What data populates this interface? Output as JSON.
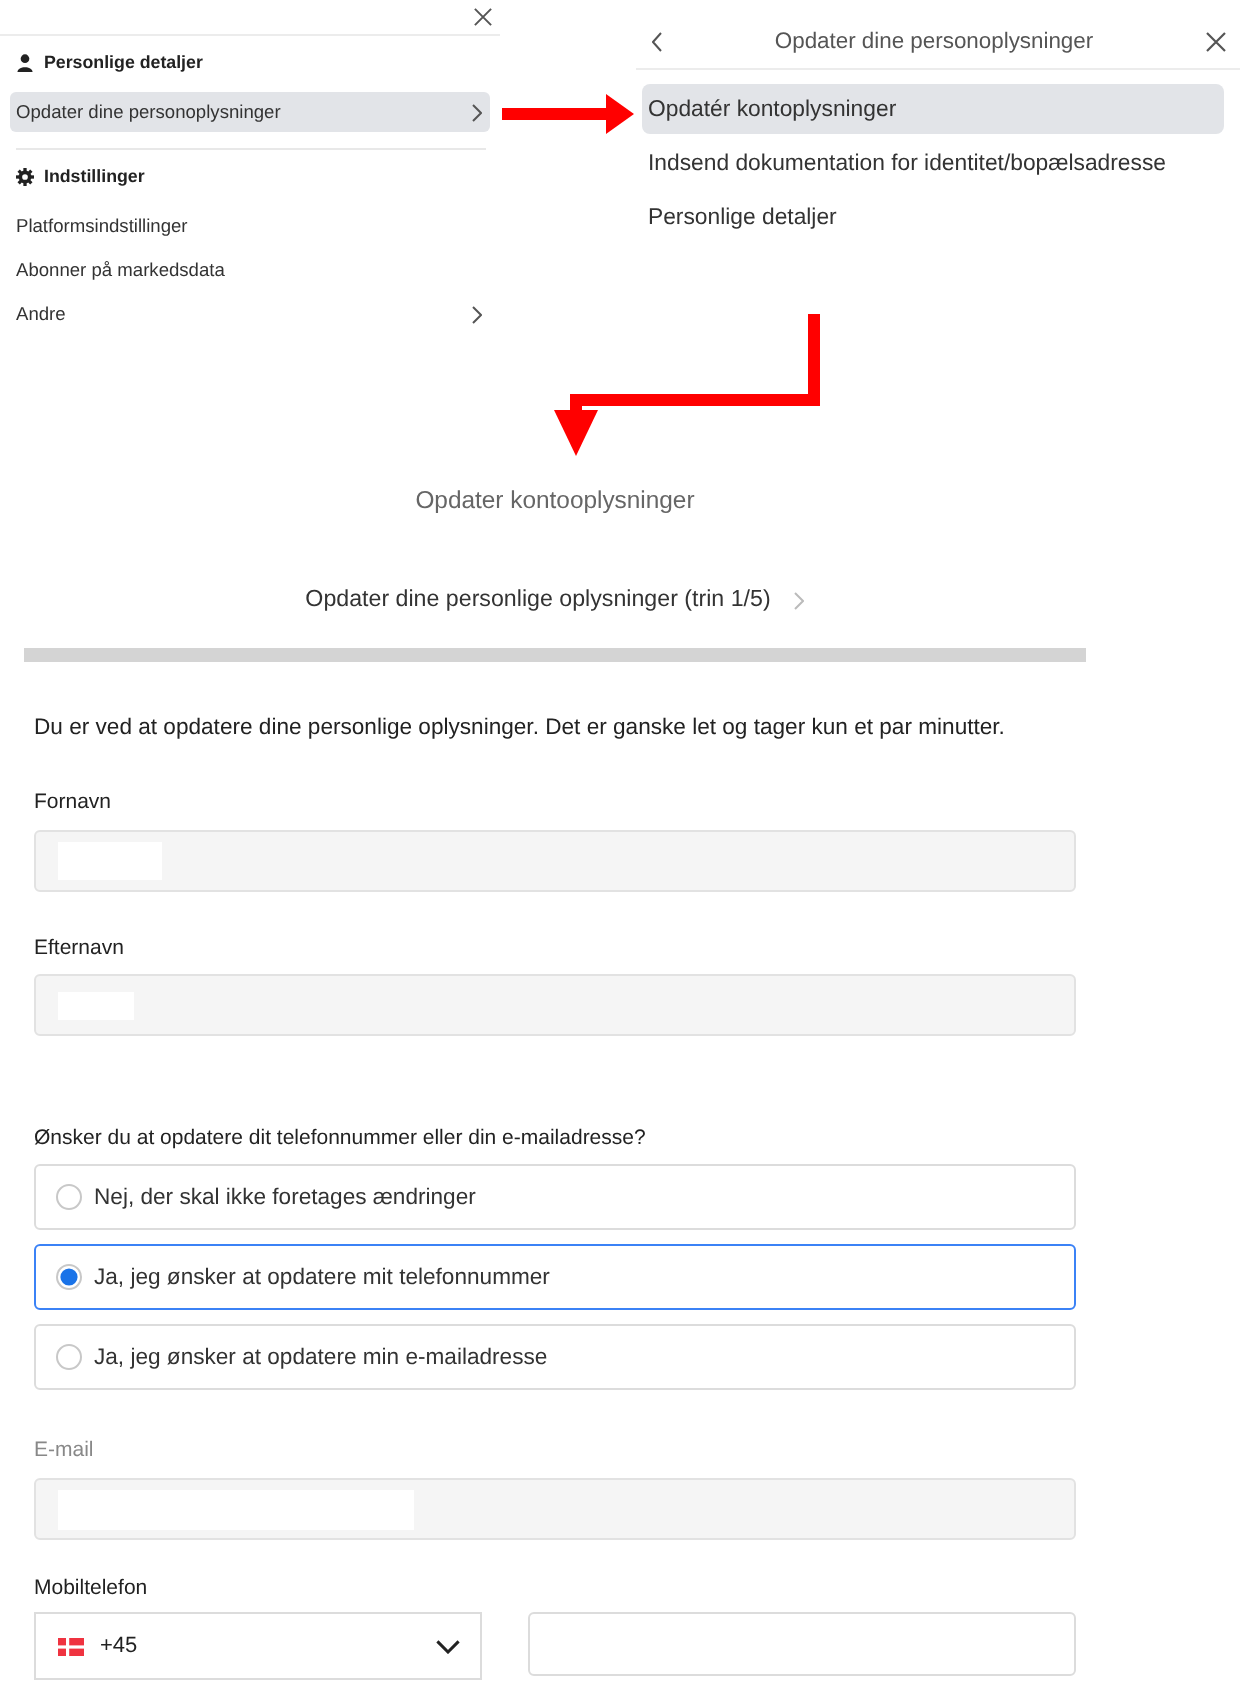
{
  "settings_menu": {
    "sections": [
      {
        "kind": "profile",
        "title": "Personlige detaljer",
        "items": [
          {
            "label": "Opdater dine personoplysninger",
            "selected": true,
            "submenu": true
          }
        ]
      },
      {
        "kind": "settings",
        "title": "Indstillinger",
        "items": [
          {
            "label": "Platformsindstillinger",
            "selected": false,
            "submenu": false
          },
          {
            "label": "Abonner på markedsdata",
            "selected": false,
            "submenu": false
          },
          {
            "label": "Andre",
            "selected": false,
            "submenu": true
          }
        ]
      }
    ]
  },
  "submenu": {
    "title": "Opdater dine personoplysninger",
    "items": [
      {
        "label": "Opdatér kontoplysninger",
        "selected": true
      },
      {
        "label": "Indsend dokumentation for identitet/bopælsadresse",
        "selected": false
      },
      {
        "label": "Personlige detaljer",
        "selected": false
      }
    ]
  },
  "form": {
    "title": "Opdater kontooplysninger",
    "step": "Opdater dine personlige oplysninger (trin 1/5)",
    "intro": "Du er ved at opdatere dine personlige oplysninger. Det er ganske let og tager kun et par minutter.",
    "name_fields": [
      {
        "label": "Fornavn",
        "disabled": false
      },
      {
        "label": "Efternavn",
        "disabled": false
      }
    ],
    "contact_question": "Ønsker du at opdatere dit telefonnummer eller din e-mailadresse?",
    "options": [
      {
        "label": "Nej, der skal ikke foretages ændringer",
        "selected": false
      },
      {
        "label": "Ja, jeg ønsker at opdatere mit telefonnummer",
        "selected": true
      },
      {
        "label": "Ja, jeg ønsker at opdatere min e-mailadresse",
        "selected": false
      }
    ],
    "email": {
      "label": "E-mail",
      "disabled": true
    },
    "phone": {
      "label": "Mobiltelefon",
      "country_code": "+45"
    }
  }
}
